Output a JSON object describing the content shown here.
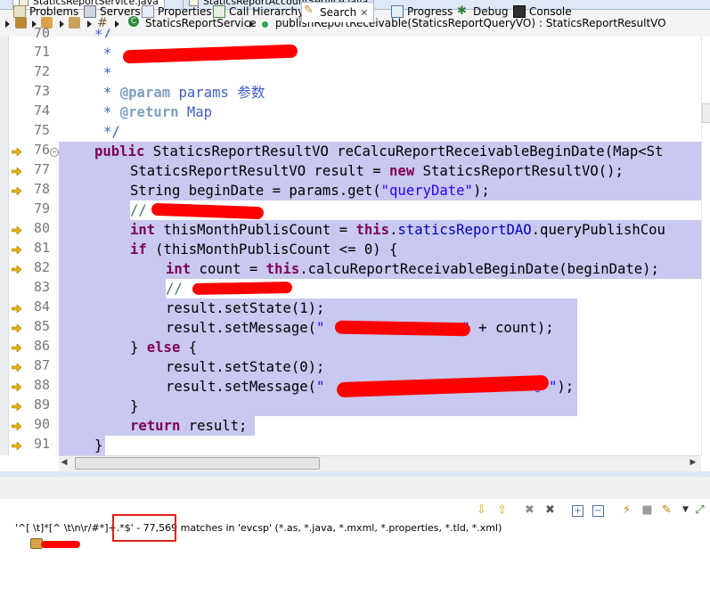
{
  "tabs": [
    {
      "label": "StaticsReportService.java",
      "active": true
    },
    {
      "label": "StaticsReportAccountService.java",
      "active": false
    }
  ],
  "breadcrumb": {
    "class_name": "StaticsReportService",
    "method_sig": "publishReportReceivable(StaticsReportQueryVO) : StaticsReportResultVO"
  },
  "editor": {
    "line_numbers": [
      "70",
      "71",
      "72",
      "73",
      "74",
      "75",
      "76",
      "77",
      "78",
      "79",
      "80",
      "81",
      "82",
      "83",
      "84",
      "85",
      "86",
      "87",
      "88",
      "89",
      "90",
      "91"
    ],
    "comment_star": "*",
    "javadoc_end": "*/",
    "param_tag": "@param",
    "param_text": " params 参数",
    "return_tag": "@return",
    "return_text": " Map",
    "code": {
      "l76_kw": "public",
      "l76_rest": " StaticsReportResultVO reCalcuReportReceivableBeginDate(Map<St",
      "l77_a": "StaticsReportResultVO result = ",
      "l77_kw": "new",
      "l77_b": " StaticsReportResultVO();",
      "l78_a": "String beginDate = params.get(",
      "l78_str": "\"queryDate\"",
      "l78_b": ");",
      "l79_cm": "//",
      "l80_kw": "int",
      "l80_a": " thisMonthPublisCount = ",
      "l80_this": "this",
      "l80_dot": ".",
      "l80_fld": "staticsReportDAO",
      "l80_b": ".queryPublishCou",
      "l81_kw": "if",
      "l81_a": " (thisMonthPublisCount <= 0) {",
      "l82_kw": "int",
      "l82_a": " count = ",
      "l82_this": "this",
      "l82_b": ".calcuReportReceivableBeginDate(beginDate);",
      "l83_cm": "//",
      "l84": "result.setState(1);",
      "l85_a": "result.setMessage(",
      "l85_str1": "\"",
      "l85_str2": "\"",
      "l85_b": " + count);",
      "l86_a": "} ",
      "l86_kw": "else",
      "l86_b": " {",
      "l87": "result.setState(0);",
      "l88_a": "result.setMessage(",
      "l88_str1": "\"",
      "l88_str2": "。\"",
      "l88_b": ");",
      "l89": "}",
      "l90_kw": "return",
      "l90_b": " result;",
      "l91": "}"
    }
  },
  "panel": {
    "tabs": [
      {
        "label": "Problems",
        "icon": "problems-icon"
      },
      {
        "label": "Servers",
        "icon": "servers-icon"
      },
      {
        "label": "Properties",
        "icon": "properties-icon"
      },
      {
        "label": "Call Hierarchy",
        "icon": "call-hierarchy-icon"
      },
      {
        "label": "Search",
        "icon": "search-icon",
        "active": true
      },
      {
        "label": "Progress",
        "icon": "progress-icon"
      },
      {
        "label": "Debug",
        "icon": "debug-icon"
      },
      {
        "label": "Console",
        "icon": "console-icon"
      }
    ],
    "close_glyph": "✕",
    "search_status": "'^[ \\t]*[^ \\t\\n\\r/#*]+.*$' - 77,569 matches in 'evcsp' (*.as, *.java, *.mxml, *.properties, *.tld, *.xml)"
  },
  "colors": {
    "selection": "#c8c8f0",
    "keyword": "#7f0055",
    "string": "#2a00ff",
    "redaction": "#ff0000",
    "highlight_box": "#e0201a"
  }
}
